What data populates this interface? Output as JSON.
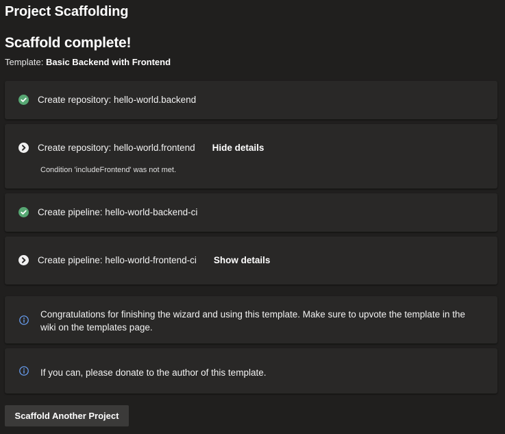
{
  "page": {
    "title": "Project Scaffolding",
    "heading": "Scaffold complete!",
    "template_label": "Template:",
    "template_name": "Basic Backend with Frontend"
  },
  "steps": [
    {
      "label": "Create repository: hello-world.backend",
      "status": "success",
      "icon": "check-circle-icon"
    },
    {
      "label": "Create repository: hello-world.frontend",
      "status": "skipped",
      "icon": "skip-circle-icon",
      "toggle": "Hide details",
      "detail": "Condition 'includeFrontend' was not met."
    },
    {
      "label": "Create pipeline: hello-world-backend-ci",
      "status": "success",
      "icon": "check-circle-icon"
    },
    {
      "label": "Create pipeline: hello-world-frontend-ci",
      "status": "skipped",
      "icon": "skip-circle-icon",
      "toggle": "Show details"
    }
  ],
  "messages": [
    {
      "text": "Congratulations for finishing the wizard and using this template. Make sure to upvote the template in the wiki on the templates page.",
      "icon": "info-icon"
    },
    {
      "text": "If you can, please donate to the author of this template.",
      "icon": "info-icon"
    }
  ],
  "actions": {
    "scaffold_another": "Scaffold Another Project"
  },
  "colors": {
    "background": "#201f1e",
    "card": "#292827",
    "success": "#57a773",
    "info": "#6ca6ff",
    "button": "#3b3a39"
  }
}
